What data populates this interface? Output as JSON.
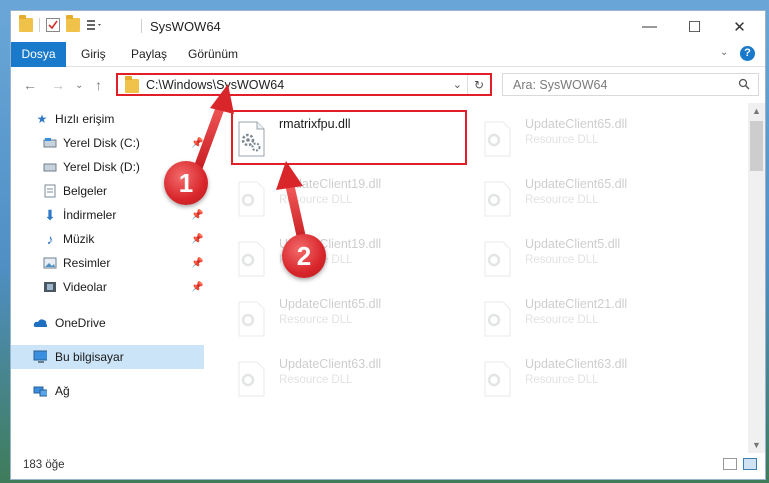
{
  "window": {
    "title": "SysWOW64",
    "controls": {
      "minimize": "—",
      "maximize": "☐",
      "close": "✕"
    }
  },
  "ribbon": {
    "tabs": [
      {
        "label": "Dosya",
        "active": true
      },
      {
        "label": "Giriş"
      },
      {
        "label": "Paylaş"
      },
      {
        "label": "Görünüm"
      }
    ],
    "help": "?"
  },
  "nav": {
    "address": "C:\\Windows\\SysWOW64",
    "search_placeholder": "Ara: SysWOW64"
  },
  "sidebar": {
    "items": [
      {
        "label": "Hızlı erişim",
        "icon": "star-icon"
      },
      {
        "label": "Yerel Disk (C:)",
        "icon": "drive-icon",
        "pinned": true
      },
      {
        "label": "Yerel Disk (D:)",
        "icon": "drive-icon"
      },
      {
        "label": "Belgeler",
        "icon": "document-icon"
      },
      {
        "label": "İndirmeler",
        "icon": "download-icon",
        "pinned": true
      },
      {
        "label": "Müzik",
        "icon": "music-icon",
        "pinned": true
      },
      {
        "label": "Resimler",
        "icon": "pictures-icon",
        "pinned": true
      },
      {
        "label": "Videolar",
        "icon": "video-icon",
        "pinned": true
      },
      {
        "label": "OneDrive",
        "icon": "cloud-icon"
      },
      {
        "label": "Bu bilgisayar",
        "icon": "computer-icon",
        "selected": true
      },
      {
        "label": "Ağ",
        "icon": "network-icon"
      }
    ]
  },
  "files": [
    {
      "name": "rmatrixfpu.dll",
      "type": ""
    },
    {
      "name": "UpdateClient65.dll",
      "type": "Resource DLL"
    },
    {
      "name": "UpdateClient19.dll",
      "type": "Resource DLL"
    },
    {
      "name": "UpdateClient65.dll",
      "type": "Resource DLL"
    },
    {
      "name": "UpdateClient19.dll",
      "type": "Resource DLL"
    },
    {
      "name": "UpdateClient5.dll",
      "type": "Resource DLL"
    },
    {
      "name": "UpdateClient65.dll",
      "type": "Resource DLL"
    },
    {
      "name": "UpdateClient21.dll",
      "type": "Resource DLL"
    },
    {
      "name": "UpdateClient63.dll",
      "type": "Resource DLL"
    },
    {
      "name": "UpdateClient63.dll",
      "type": "Resource DLL"
    }
  ],
  "status": {
    "count": "183 öğe"
  },
  "callouts": {
    "one": "1",
    "two": "2"
  },
  "colors": {
    "accent": "#1979ca",
    "highlight": "#e21f26"
  }
}
